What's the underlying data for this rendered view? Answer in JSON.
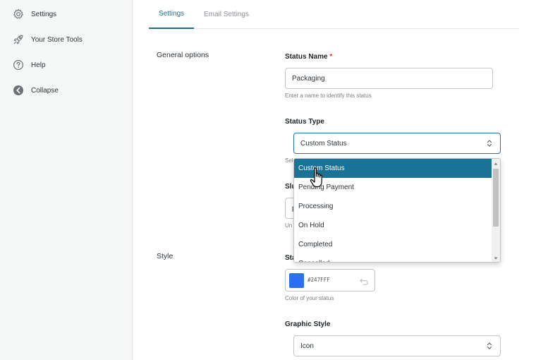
{
  "sidebar": {
    "items": [
      {
        "label": "Settings",
        "icon": "gear-icon"
      },
      {
        "label": "Your Store Tools",
        "icon": "rocket-icon"
      },
      {
        "label": "Help",
        "icon": "help-circle-icon"
      },
      {
        "label": "Collapse",
        "icon": "collapse-arrow-icon"
      }
    ]
  },
  "tabs": [
    {
      "label": "Settings",
      "active": true
    },
    {
      "label": "Email Settings",
      "active": false
    }
  ],
  "sections": {
    "general": "General options",
    "style": "Style"
  },
  "status_name": {
    "label": "Status Name",
    "required_mark": "*",
    "value": "Packaging",
    "help": "Enter a name to identify this status"
  },
  "status_type": {
    "label": "Status Type",
    "value": "Custom Status",
    "help_partial": "Sele",
    "options": [
      "Custom Status",
      "Pending Payment",
      "Processing",
      "On Hold",
      "Completed",
      "Cancelled"
    ],
    "selected_index": 0
  },
  "slug": {
    "label_partial": "Slu",
    "value_partial": "p",
    "help_partial": "Un"
  },
  "status_color": {
    "label_partial": "Sta",
    "hex": "#247FFF",
    "swatch_color": "#2b6ff2",
    "help": "Color of your status"
  },
  "graphic_style": {
    "label": "Graphic Style",
    "value": "Icon"
  },
  "colors": {
    "accent": "#1f6d8f",
    "selected_option": "#1a7296",
    "focus_border": "#2271b1"
  }
}
